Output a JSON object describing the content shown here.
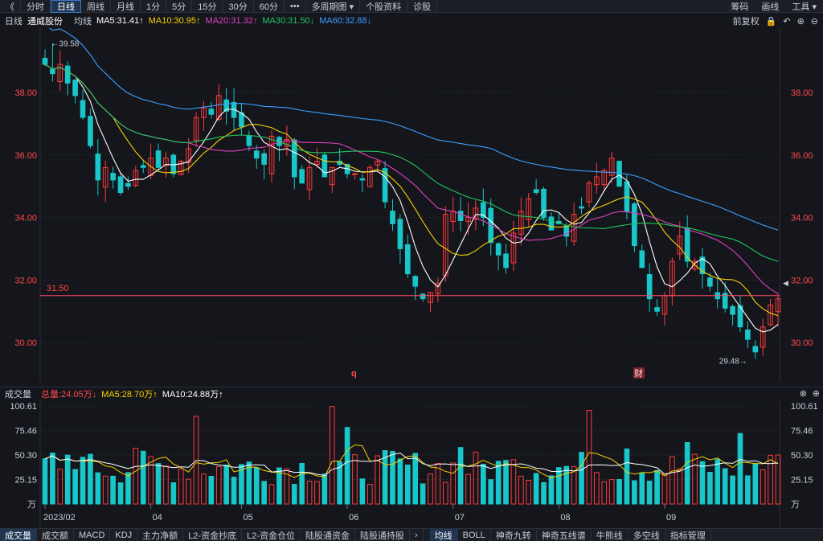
{
  "toolbar": {
    "back": "《",
    "tabs": [
      "分时",
      "日线",
      "周线",
      "月线",
      "1分",
      "5分",
      "15分",
      "30分",
      "60分",
      "•••",
      "多周期图 ▾",
      "个股资料",
      "诊股"
    ],
    "active_tab": "日线",
    "right": [
      "筹码",
      "画线",
      "工具 ▾"
    ]
  },
  "title": {
    "period": "日线",
    "stock_name": "通威股份",
    "ma_label": "均线",
    "ma5": "MA5:31.41↑",
    "ma10": "MA10:30.95↑",
    "ma20": "MA20:31.32↑",
    "ma30": "MA30:31.50↓",
    "ma60": "MA60:32.88↓",
    "adjust": "前复权"
  },
  "colors": {
    "up": "#ff3b3b",
    "down": "#19c6c9",
    "ma5": "#ffffff",
    "ma10": "#f5d000",
    "ma20": "#e040c0",
    "ma30": "#22c55e",
    "ma60": "#3ba0ff",
    "axis": "#ff4a4a",
    "bg": "#14161c",
    "grid": "#262a33"
  },
  "price_axis": {
    "labels": [
      "38.00",
      "36.00",
      "34.00",
      "32.00",
      "30.00"
    ]
  },
  "annotations": {
    "high": "←39.58",
    "low": "29.48→",
    "line_label": "31.50",
    "marker_q": "q",
    "marker_cai": "财"
  },
  "volume": {
    "title": "成交量",
    "total": "总量:24.05万↓",
    "ma5": "MA5:28.70万↑",
    "ma10": "MA10:24.88万↑",
    "axis_labels": [
      "100.61",
      "75.46",
      "50.30",
      "25.15",
      "万"
    ]
  },
  "months": [
    "2023/02",
    "04",
    "05",
    "06",
    "07",
    "08",
    "09"
  ],
  "bottom_tabs": [
    "成交量",
    "成交额",
    "MACD",
    "KDJ",
    "主力净额",
    "L2-资金抄底",
    "L2-资金仓位",
    "陆股通资金",
    "陆股通持股",
    "›",
    "均线",
    "BOLL",
    "神奇九转",
    "神奇五线谱",
    "牛熊线",
    "多空线",
    "指标管理"
  ],
  "chart_data": {
    "type": "candlestick",
    "title": "通威股份 日线",
    "y_range": [
      29.0,
      39.8
    ],
    "ticks": [
      38.0,
      36.0,
      34.0,
      32.0,
      30.0
    ],
    "high": 39.58,
    "low": 29.48,
    "reference_line": 31.5,
    "closes": [
      38.9,
      38.6,
      38.9,
      38.3,
      37.9,
      37.2,
      36.3,
      35.2,
      35.6,
      35.2,
      34.8,
      35.0,
      35.5,
      35.6,
      35.9,
      35.6,
      35.9,
      35.4,
      35.8,
      36.2,
      37.2,
      37.5,
      37.3,
      37.9,
      37.4,
      37.2,
      36.9,
      36.3,
      35.9,
      35.7,
      36.6,
      36.3,
      36.5,
      35.3,
      35.1,
      35.6,
      35.8,
      35.3,
      35.6,
      35.7,
      35.4,
      35.4,
      35.2,
      35.6,
      35.8,
      34.5,
      33.8,
      33.0,
      32.2,
      31.8,
      31.4,
      31.6,
      31.9,
      34.1,
      34.2,
      33.9,
      34.0,
      34.3,
      34.0,
      33.2,
      32.8,
      32.4,
      33.5,
      34.2,
      34.6,
      34.8,
      34.0,
      33.6,
      33.8,
      33.4,
      34.1,
      34.3,
      35.1,
      35.3,
      35.5,
      35.9,
      35.0,
      34.2,
      33.1,
      32.4,
      31.4,
      31.0,
      31.5,
      32.6,
      33.4,
      32.6,
      32.6,
      32.2,
      31.8,
      31.4,
      31.1,
      30.9,
      30.5,
      30.1,
      29.7,
      30.5,
      31.2,
      31.4
    ]
  }
}
